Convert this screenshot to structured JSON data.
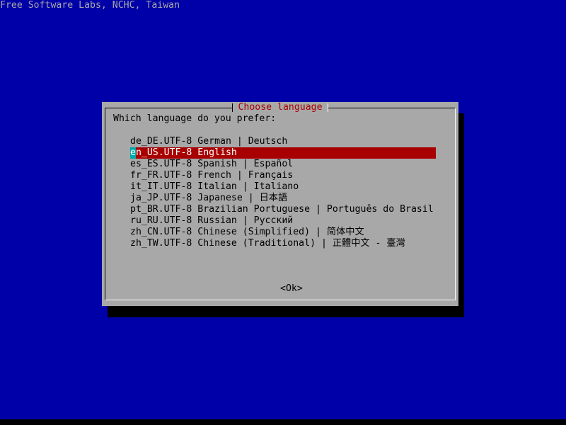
{
  "banner": "Free Software Labs, NCHC, Taiwan",
  "dialog": {
    "title": "Choose language",
    "prompt": "Which language do you prefer:",
    "items": [
      {
        "label": "de_DE.UTF-8 German | Deutsch"
      },
      {
        "label": "en_US.UTF-8 English"
      },
      {
        "label": "es_ES.UTF-8 Spanish | Español"
      },
      {
        "label": "fr_FR.UTF-8 French | Français"
      },
      {
        "label": "it_IT.UTF-8 Italian | Italiano"
      },
      {
        "label": "ja_JP.UTF-8 Japanese | 日本語"
      },
      {
        "label": "pt_BR.UTF-8 Brazilian Portuguese | Português do Brasil"
      },
      {
        "label": "ru_RU.UTF-8 Russian | Русский"
      },
      {
        "label": "zh_CN.UTF-8 Chinese (Simplified) | 简体中文"
      },
      {
        "label": "zh_TW.UTF-8 Chinese (Traditional) | 正體中文 - 臺灣"
      }
    ],
    "selected_index": 1,
    "ok_label": "<Ok>"
  },
  "colors": {
    "background": "#0000a8",
    "dialog": "#a8a8a8",
    "title_text": "#a80000",
    "selection": "#a80000",
    "cursor": "#00a8a8"
  }
}
